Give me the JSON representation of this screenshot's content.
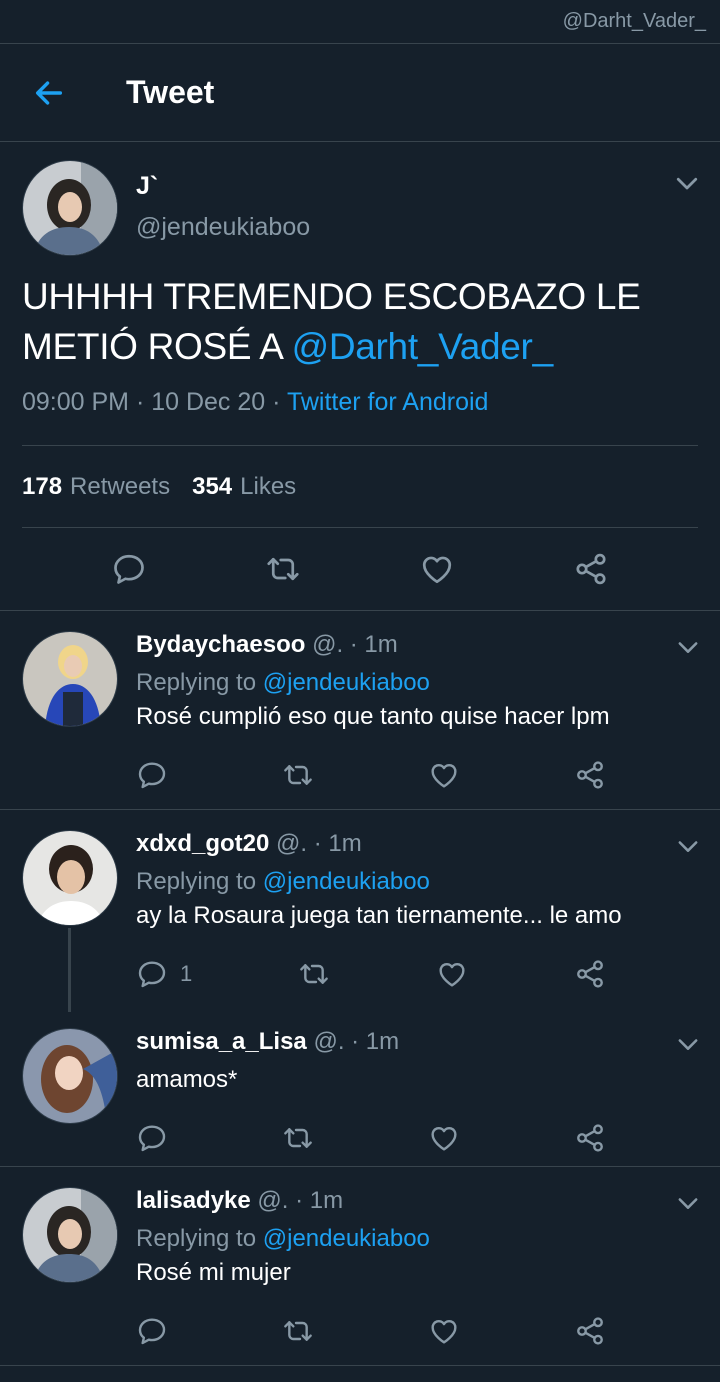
{
  "watermark": "@Darht_Vader_",
  "header": {
    "title": "Tweet"
  },
  "tweet": {
    "display_name": "J`",
    "handle": "@jendeukiaboo",
    "text_before": "UHHHH TREMENDO ESCOBAZO LE METIÓ ROSÉ A ",
    "mention": "@Darht_Vader_",
    "time": "09:00 PM · 10 Dec 20 · ",
    "source": "Twitter for Android",
    "retweets_count": "178",
    "retweets_label": "Retweets",
    "likes_count": "354",
    "likes_label": "Likes"
  },
  "replies": [
    {
      "name": "Bydaychaesoo",
      "meta": " @. · 1m",
      "replying_label": "Replying to ",
      "replying_to": "@jendeukiaboo",
      "text": "Rosé cumplió eso que tanto quise hacer lpm",
      "reply_count": ""
    },
    {
      "name": "xdxd_got20",
      "meta": " @. · 1m",
      "replying_label": "Replying to ",
      "replying_to": "@jendeukiaboo",
      "text": "ay la Rosaura juega tan tiernamente... le amo",
      "reply_count": "1"
    },
    {
      "name": "sumisa_a_Lisa",
      "meta": " @. · 1m",
      "text": "amamos*",
      "reply_count": ""
    },
    {
      "name": "lalisadyke",
      "meta": " @. · 1m",
      "replying_label": "Replying to ",
      "replying_to": "@jendeukiaboo",
      "text": "Rosé mi mujer",
      "reply_count": ""
    }
  ],
  "icons": {
    "back": "arrow-left-icon",
    "reply": "speech-bubble-icon",
    "retweet": "retweet-icon",
    "like": "heart-icon",
    "share": "share-icon",
    "more": "chevron-down-icon"
  },
  "colors": {
    "background": "#15202b",
    "accent": "#1da1f2",
    "muted": "#8899a6",
    "divider": "#38444d"
  }
}
